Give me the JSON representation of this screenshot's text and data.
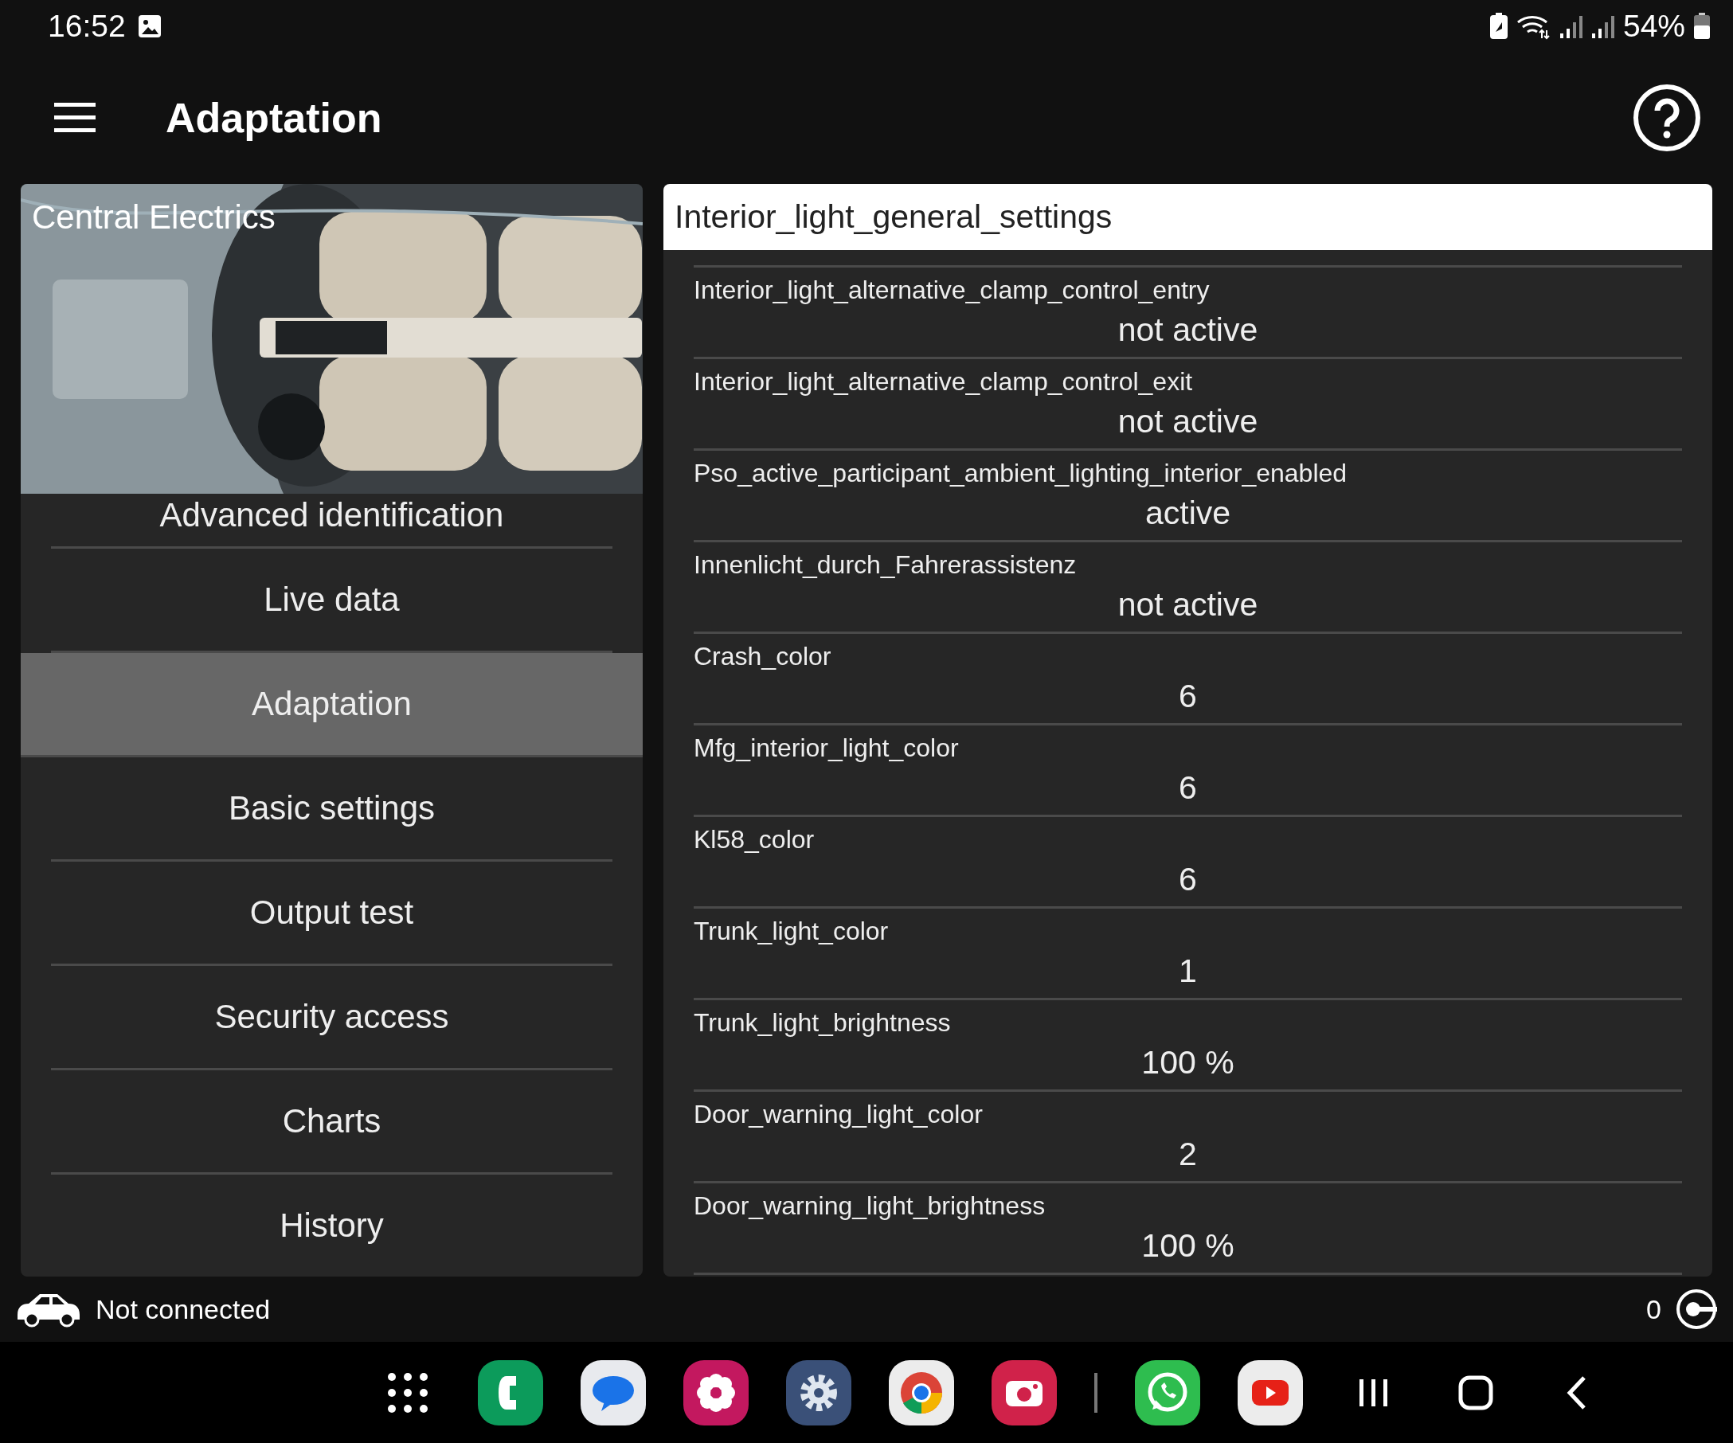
{
  "status_bar": {
    "time": "16:52",
    "battery": "54%"
  },
  "app_bar": {
    "title": "Adaptation"
  },
  "module": {
    "title": "Central Electrics"
  },
  "menu": [
    {
      "label": "Advanced identification",
      "selected": false
    },
    {
      "label": "Live data",
      "selected": false
    },
    {
      "label": "Adaptation",
      "selected": true
    },
    {
      "label": "Basic settings",
      "selected": false
    },
    {
      "label": "Output test",
      "selected": false
    },
    {
      "label": "Security access",
      "selected": false
    },
    {
      "label": "Charts",
      "selected": false
    },
    {
      "label": "History",
      "selected": false
    }
  ],
  "settings": {
    "group": "Interior_light_general_settings",
    "rows": [
      {
        "name": "Interior_light_alternative_clamp_control_entry",
        "value": "not active"
      },
      {
        "name": "Interior_light_alternative_clamp_control_exit",
        "value": "not active"
      },
      {
        "name": "Pso_active_participant_ambient_lighting_interior_enabled",
        "value": "active"
      },
      {
        "name": "Innenlicht_durch_Fahrerassistenz",
        "value": "not active"
      },
      {
        "name": "Crash_color",
        "value": "6"
      },
      {
        "name": "Mfg_interior_light_color",
        "value": "6"
      },
      {
        "name": "Kl58_color",
        "value": "6"
      },
      {
        "name": "Trunk_light_color",
        "value": "1"
      },
      {
        "name": "Trunk_light_brightness",
        "value": "100 %"
      },
      {
        "name": "Door_warning_light_color",
        "value": "2"
      },
      {
        "name": "Door_warning_light_brightness",
        "value": "100 %"
      }
    ]
  },
  "footer": {
    "connection": "Not connected",
    "count": "0"
  }
}
